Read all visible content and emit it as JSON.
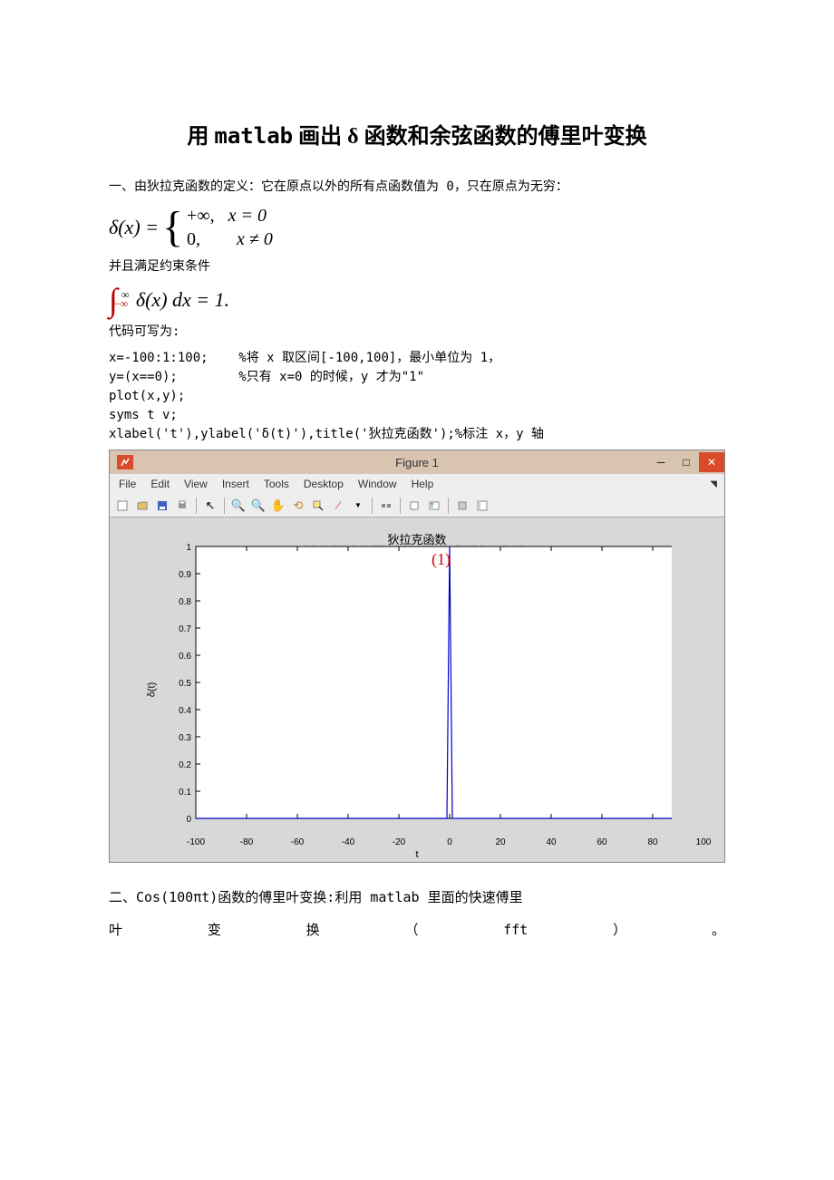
{
  "title_prefix": "用",
  "title_matlab": "matlab",
  "title_mid": "画出",
  "title_delta": "δ",
  "title_suffix": "函数和余弦函数的傅里叶变换",
  "para_intro": "一、由狄拉克函数的定义：它在原点以外的所有点函数值为 0，只在原点为无穷：",
  "formula_delta_left": "δ(x) =",
  "formula_case1_left": "+∞,",
  "formula_case1_right": "x = 0",
  "formula_case2_left": "0,",
  "formula_case2_right": "x ≠ 0",
  "constraint_label": "并且满足约束条件",
  "formula_integral": "∫",
  "formula_integral_upper": "∞",
  "formula_integral_lower": "−∞",
  "formula_integral_body": "δ(x) dx = 1.",
  "code_label": "代码可写为:",
  "code1": "x=-100:1:100;",
  "code1_comment": "%将 x 取区间[-100,100]，最小单位为 1，",
  "code2": "y=(x==0);",
  "code2_comment": "%只有 x=0 的时候，y 才为\"1\"",
  "code3": "plot(x,y);",
  "code4": "syms t v;",
  "code5": "xlabel('t'),ylabel('δ(t)'),title('狄拉克函数');",
  "code5_comment": "%标注 x，y 轴",
  "figure": {
    "window_title": "Figure 1",
    "menu": [
      "File",
      "Edit",
      "View",
      "Insert",
      "Tools",
      "Desktop",
      "Window",
      "Help"
    ],
    "plot_title": "狄拉克函数",
    "annotation": "(1)",
    "ylabel": "δ(t)",
    "xlabel": "t",
    "watermark": "www.zixw.com.cn"
  },
  "para2_line1": "二、Cos(100πt)函数的傅里叶变换:利用 matlab 里面的快速傅里",
  "para2_row": [
    "叶",
    "变",
    "换",
    "（",
    "fft",
    "）",
    "。"
  ],
  "chart_data": {
    "type": "line",
    "title": "狄拉克函数",
    "xlabel": "t",
    "ylabel": "δ(t)",
    "xlim": [
      -100,
      100
    ],
    "ylim": [
      0,
      1
    ],
    "xticks": [
      -100,
      -80,
      -60,
      -40,
      -20,
      0,
      20,
      40,
      60,
      80,
      100
    ],
    "yticks": [
      0,
      0.1,
      0.2,
      0.3,
      0.4,
      0.5,
      0.6,
      0.7,
      0.8,
      0.9,
      1
    ],
    "series": [
      {
        "name": "δ(t)",
        "description": "Dirac delta impulse: 0 everywhere except t=0 where value=1",
        "impulse_at": 0,
        "impulse_value": 1
      }
    ]
  }
}
